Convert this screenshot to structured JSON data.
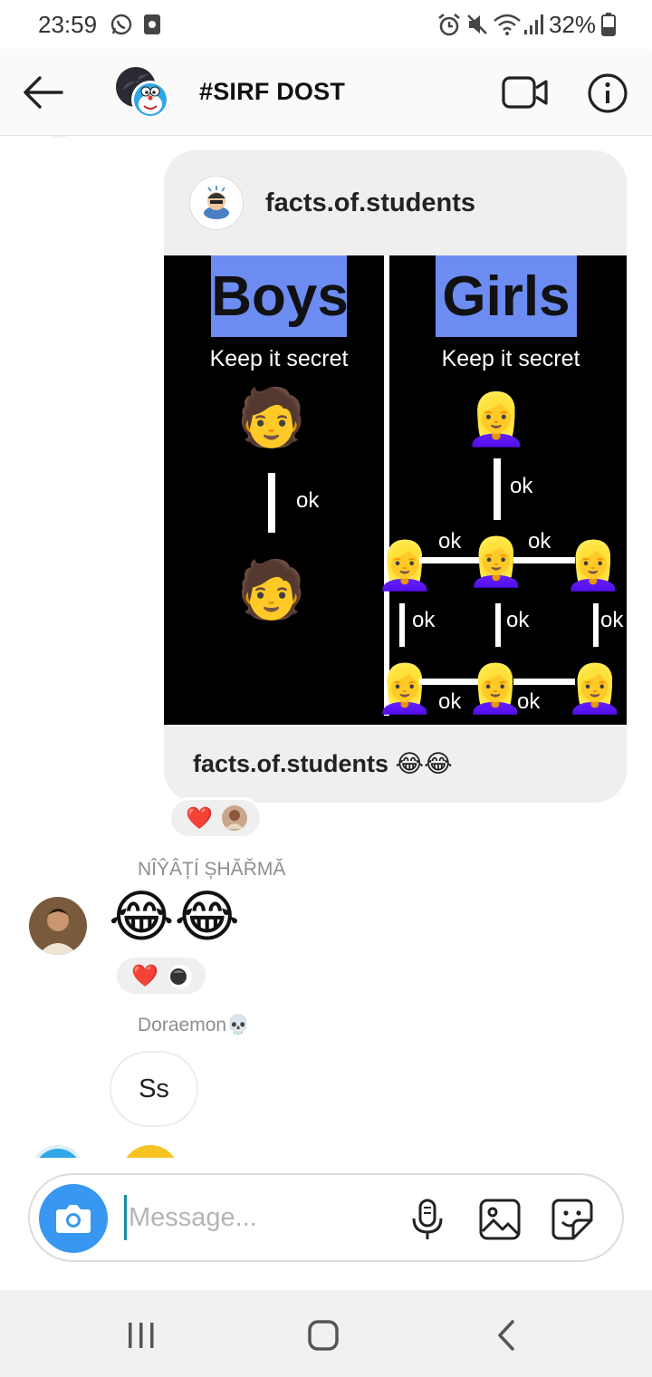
{
  "status_bar": {
    "time": "23:59",
    "battery_percent": "32%",
    "icons": [
      "whatsapp-icon",
      "app-notification-icon",
      "alarm-icon",
      "mute-icon",
      "wifi-icon",
      "signal-icon",
      "battery-icon"
    ]
  },
  "header": {
    "title": "#SIRF DOST",
    "icons": [
      "back-arrow-icon",
      "video-call-icon",
      "info-icon"
    ]
  },
  "messages": {
    "shared_post": {
      "username": "facts.of.students",
      "caption": "facts.of.students 😂😂",
      "meme": {
        "left_title": "Boys",
        "left_subtitle": "Keep it secret",
        "right_title": "Girls",
        "right_subtitle": "Keep it secret",
        "ok": "ok",
        "boy_emoji": "🧑",
        "girl_emoji": "👱‍♀️"
      },
      "reaction": "❤️"
    },
    "niyati": {
      "sender": "NÎŶÂȚÍ ȘHĂŘMĂ",
      "content": "😂😂",
      "reaction": "❤️"
    },
    "doraemon": {
      "sender": "Doraemon💀",
      "content": "Ss"
    }
  },
  "composer": {
    "placeholder": "Message...",
    "value": "",
    "icons": [
      "camera-icon",
      "microphone-icon",
      "gallery-icon",
      "sticker-icon"
    ]
  },
  "navigation": {
    "icons": [
      "recent-apps-icon",
      "home-icon",
      "back-icon"
    ]
  },
  "colors": {
    "accent": "#3897f0",
    "bubble_gray": "#efefef",
    "meta_text": "#8e8e8e",
    "meme_header_blue": "#6c8cf2",
    "heart_red": "#ed1c24"
  }
}
